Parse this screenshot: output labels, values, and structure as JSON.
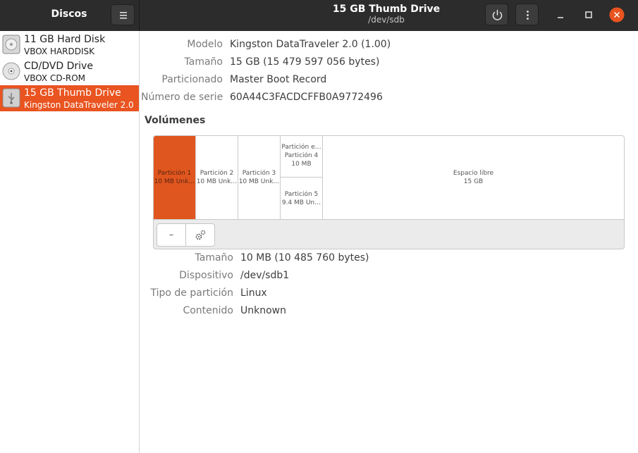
{
  "header": {
    "app_title": "Discos",
    "window_title": "15 GB Thumb Drive",
    "window_subtitle": "/dev/sdb",
    "menu_icon": "hamburger-menu-icon",
    "power_icon": "power-icon",
    "more_icon": "vertical-ellipsis-icon",
    "close_color": "#e95420"
  },
  "drives": [
    {
      "name": "11 GB Hard Disk",
      "model": "VBOX HARDDISK",
      "icon": "hard-disk-icon",
      "selected": false
    },
    {
      "name": "CD/DVD Drive",
      "model": "VBOX CD-ROM",
      "icon": "optical-disc-icon",
      "selected": false
    },
    {
      "name": "15 GB Thumb Drive",
      "model": "Kingston DataTraveler 2.0",
      "icon": "usb-drive-icon",
      "selected": true
    }
  ],
  "drive_props": {
    "model_label": "Modelo",
    "model_value": "Kingston DataTraveler 2.0 (1.00)",
    "size_label": "Tamaño",
    "size_value": "15 GB (15 479 597 056 bytes)",
    "partitioning_label": "Particionado",
    "partitioning_value": "Master Boot Record",
    "serial_label": "Número de serie",
    "serial_value": "60A44C3FACDCFFB0A9772496"
  },
  "volumes": {
    "title": "Volúmenes",
    "partitions": [
      {
        "label": "Partición 1",
        "size": "10 MB Unk…",
        "selected": true
      },
      {
        "label": "Partición 2",
        "size": "10 MB Unk…",
        "selected": false
      },
      {
        "label": "Partición 3",
        "size": "10 MB Unk…",
        "selected": false
      },
      {
        "label": "Partición e…",
        "size": "",
        "selected": false
      },
      {
        "label": "Partición 4",
        "size": "10 MB",
        "selected": false
      },
      {
        "label": "Partición 5",
        "size": "9.4 MB Un…",
        "selected": false
      },
      {
        "label": "Espacio libre",
        "size": "15 GB",
        "selected": false
      }
    ],
    "toolbar": {
      "remove_label": "–",
      "settings_icon": "gears-icon"
    }
  },
  "partition_props": {
    "size_label": "Tamaño",
    "size_value": "10 MB (10 485 760 bytes)",
    "device_label": "Dispositivo",
    "device_value": "/dev/sdb1",
    "type_label": "Tipo de partición",
    "type_value": "Linux",
    "contents_label": "Contenido",
    "contents_value": "Unknown"
  },
  "colors": {
    "accent": "#e95420",
    "headerbar": "#2c2c2c"
  }
}
